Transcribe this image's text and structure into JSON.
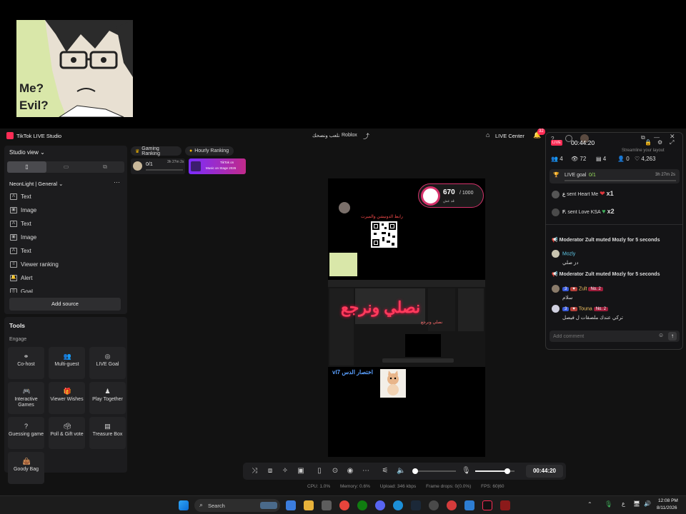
{
  "app": {
    "title": "TikTok LIVE Studio",
    "stream_title": "نلعب ونضحك",
    "category": "Roblox",
    "live_center_label": "LIVE Center",
    "notification_count": "32"
  },
  "webcam_overlay": {
    "text1": "Me?",
    "text2": "Evil?"
  },
  "sidebar": {
    "view_label": "Studio view",
    "scene_name": "NeonLight | General",
    "sources": [
      {
        "label": "Text",
        "icon": "text-icon"
      },
      {
        "label": "Image",
        "icon": "image-icon"
      },
      {
        "label": "Text",
        "icon": "text-icon"
      },
      {
        "label": "Image",
        "icon": "image-icon"
      },
      {
        "label": "Text",
        "icon": "text-icon"
      },
      {
        "label": "Viewer ranking",
        "icon": "list-icon"
      },
      {
        "label": "Alert",
        "icon": "bell-icon"
      },
      {
        "label": "Goal",
        "icon": "goal-icon"
      }
    ],
    "add_source_label": "Add source"
  },
  "tools": {
    "heading": "Tools",
    "section": "Engage",
    "items": [
      {
        "label": "Co-host",
        "icon": "cohost-icon"
      },
      {
        "label": "Multi-guest",
        "icon": "multi-guest-icon"
      },
      {
        "label": "LIVE Goal",
        "icon": "goal-icon"
      },
      {
        "label": "Interactive Games",
        "icon": "gamepad-icon"
      },
      {
        "label": "Viewer Wishes",
        "icon": "gift-icon"
      },
      {
        "label": "Play Together",
        "icon": "play-together-icon"
      },
      {
        "label": "Guessing game",
        "icon": "question-icon"
      },
      {
        "label": "Poll & Gift vote",
        "icon": "poll-icon"
      },
      {
        "label": "Treasure Box",
        "icon": "treasure-icon"
      },
      {
        "label": "Goody Bag",
        "icon": "bag-icon"
      }
    ]
  },
  "rankings": {
    "gaming": "Gaming Ranking",
    "hourly": "Hourly Ranking",
    "goal_progress": "0/1",
    "goal_time": "3h 27m 2s",
    "promo_line1": "TikTok on",
    "promo_line2": "Music on Stage 2026"
  },
  "preview": {
    "counter_value": "670",
    "counter_max": "/ 1000",
    "counter_sub": "قد عش",
    "link_text": "رابط الدونيشن والميرت",
    "big_arabic": "نصلي ونرجع",
    "small_arabic": "نصلي ونرجع",
    "bottom_text": "vl7 اختصار الدس"
  },
  "controls": {
    "timer": "00:44:20",
    "mic_level": 0.82,
    "volume_level": 0.05
  },
  "status": {
    "cpu": "CPU:  1.0%",
    "memory": "Memory:  0.6%",
    "upload": "Upload:  346 kbps",
    "frame_drops": "Frame drops:  0(0.0%)",
    "fps": "FPS:  60|60"
  },
  "live_panel": {
    "live_badge": "LIVE",
    "timer": "00:44:20",
    "streamline": "Streamline your layout",
    "stats": [
      {
        "icon": "users-icon",
        "value": "4"
      },
      {
        "icon": "eye-icon",
        "value": "72"
      },
      {
        "icon": "board-icon",
        "value": "4"
      },
      {
        "icon": "person-icon",
        "value": "0"
      },
      {
        "icon": "heart-icon",
        "value": "4,263"
      }
    ],
    "goal_label": "LIVE goal",
    "goal_value": "0/1",
    "goal_time": "3h 27m 2s",
    "gifts": [
      {
        "user": "ع",
        "text": "sent Heart Me",
        "count": "x1"
      },
      {
        "user": "F.",
        "text": "sent Love KSA",
        "count": "x2"
      }
    ],
    "chat": [
      {
        "kind": "system",
        "text": "Moderator Zult muted Mozly for 5 seconds"
      },
      {
        "kind": "msg",
        "user": "Mozly",
        "message": "دز صلي"
      },
      {
        "kind": "system",
        "text": "Moderator Zult muted Mozly for 5 seconds"
      },
      {
        "kind": "msg",
        "user": "Zult",
        "level": "3",
        "rank": "No. 2",
        "message": "سلام"
      },
      {
        "kind": "msg",
        "user": "Touna",
        "level": "3",
        "rank": "No. 2",
        "message": "تركي عندك ملصقات ل فيصل"
      }
    ],
    "comment_placeholder": "Add comment"
  },
  "taskbar": {
    "search_placeholder": "Search",
    "time": "12:08 PM",
    "date": "8/11/2026",
    "lang": "ع"
  }
}
